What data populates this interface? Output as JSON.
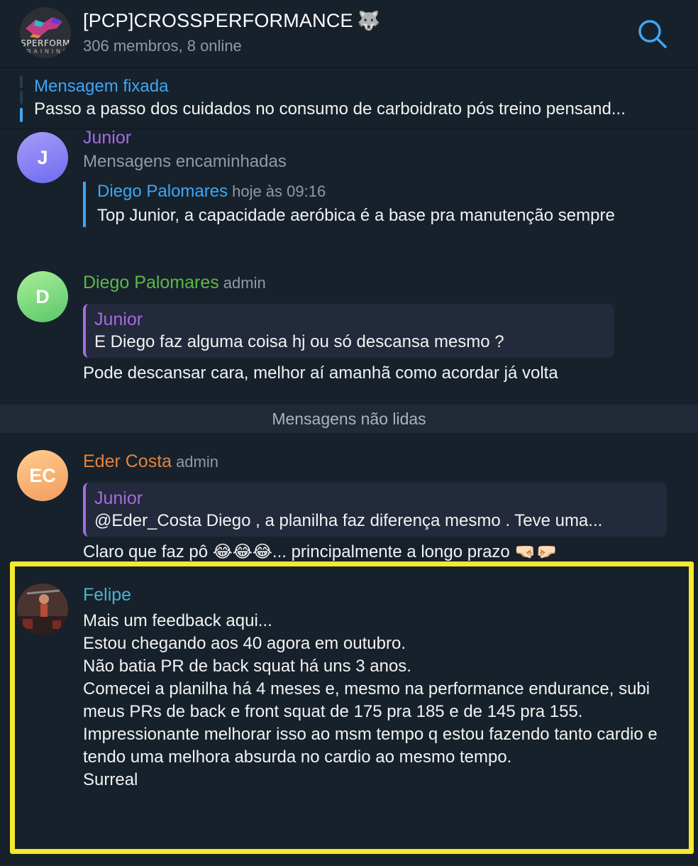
{
  "header": {
    "avatar_logo_text": "SPERFORM",
    "avatar_logo_sub": "TRAINING",
    "title": "[PCP]CROSSPERFORMANCE",
    "title_emoji": "🐺",
    "subtitle": "306 membros, 8 online",
    "search_icon": "search-icon"
  },
  "pinned": {
    "label": "Mensagem fixada",
    "text": "Passo a passo dos cuidados no consumo de carboidrato pós treino pensand..."
  },
  "messages": [
    {
      "avatar_initials": "J",
      "sender": "Junior",
      "forward_header": "Mensagens encaminhadas",
      "forward_name": "Diego Palomares",
      "forward_time": "hoje às 09:16",
      "forward_text": "Top Junior, a capacidade aeróbica é a base pra manutenção sempre"
    },
    {
      "avatar_initials": "D",
      "sender": "Diego Palomares",
      "role": "admin",
      "quote_name": "Junior",
      "quote_text": "E Diego faz alguma coisa hj ou só descansa mesmo ?",
      "text": "Pode descansar cara, melhor aí amanhã como acordar já volta"
    },
    {
      "avatar_initials": "EC",
      "sender": "Eder Costa",
      "role": "admin",
      "quote_name": "Junior",
      "quote_text": "@Eder_Costa Diego , a planilha faz diferença mesmo . Teve uma...",
      "text": "Claro que faz pô 😂😂😂... principalmente a longo prazo 🤜🏻🤛🏻"
    },
    {
      "sender": "Felipe",
      "lines": [
        "Mais um feedback aqui...",
        "Estou chegando aos 40 agora em outubro.",
        "Não batia PR de back squat há uns 3 anos.",
        "Comecei a planilha há 4 meses e, mesmo na performance endurance, subi meus PRs de back e front squat de 175 pra 185 e de 145 pra 155.",
        "Impressionante melhorar isso ao msm tempo q estou fazendo tanto cardio e tendo uma melhora absurda no cardio ao mesmo tempo.",
        "Surreal"
      ]
    }
  ],
  "unread_divider": "Mensagens não lidas",
  "colors": {
    "background": "#17212b",
    "accent_blue": "#3fa6f5",
    "junior_purple": "#a56be0",
    "diego_green": "#5cb84a",
    "eder_orange": "#e5833e",
    "felipe_teal": "#4ab3cf",
    "highlight_yellow": "#f3ea2b"
  }
}
